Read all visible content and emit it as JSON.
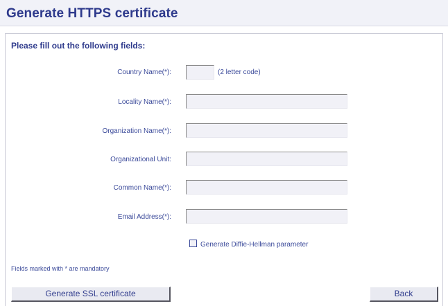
{
  "header": {
    "title": "Generate HTTPS certificate"
  },
  "form": {
    "subtitle": "Please fill out the following fields:",
    "fields": [
      {
        "label": "Country Name(*):",
        "value": "",
        "hint": "(2 letter code)"
      },
      {
        "label": "Locality Name(*):",
        "value": ""
      },
      {
        "label": "Organization Name(*):",
        "value": ""
      },
      {
        "label": "Organizational Unit:",
        "value": ""
      },
      {
        "label": "Common Name(*):",
        "value": ""
      },
      {
        "label": "Email Address(*):",
        "value": ""
      }
    ],
    "checkbox": {
      "label": "Generate Diffie-Hellman parameter",
      "checked": false
    },
    "note": "Fields marked with * are mandatory"
  },
  "buttons": {
    "generate": "Generate SSL certificate",
    "back": "Back"
  },
  "colors": {
    "accent": "#2e3a8c",
    "label": "#3b4a9a",
    "header_bg": "#f1f2f8"
  }
}
